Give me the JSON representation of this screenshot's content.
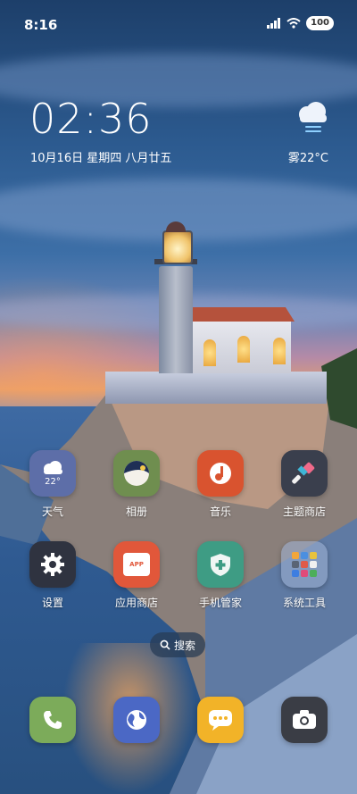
{
  "status_bar": {
    "time": "8:16",
    "battery": "100"
  },
  "clock_widget": {
    "time": "02:36",
    "date": "10月16日 星期四 八月廿五"
  },
  "weather_widget": {
    "text": "雾22°C",
    "icon": "cloud-fog-icon"
  },
  "apps": [
    {
      "name": "weather",
      "label": "天气",
      "temp": "22°",
      "icon": "cloud-icon",
      "color": "#5d6ea8"
    },
    {
      "name": "gallery",
      "label": "相册",
      "icon": "gallery-icon",
      "color": "#6f8e4f"
    },
    {
      "name": "music",
      "label": "音乐",
      "icon": "music-note-icon",
      "color": "#d9532f"
    },
    {
      "name": "themes",
      "label": "主题商店",
      "icon": "paintbrush-icon",
      "color": "#3a3f4d"
    },
    {
      "name": "settings",
      "label": "设置",
      "icon": "gear-icon",
      "color": "#2f3340"
    },
    {
      "name": "app-store",
      "label": "应用商店",
      "icon": "shopping-bag-icon",
      "badge": "APP",
      "color": "#e1573a"
    },
    {
      "name": "security",
      "label": "手机管家",
      "icon": "shield-icon",
      "color": "#3e9c84"
    },
    {
      "name": "system-tools",
      "label": "系统工具",
      "icon": "folder-icon",
      "color": "#8fa2c4"
    }
  ],
  "search": {
    "label": "搜索",
    "icon": "search-icon"
  },
  "dock": [
    {
      "name": "phone",
      "icon": "phone-icon",
      "color": "#7cab5a"
    },
    {
      "name": "browser",
      "icon": "globe-icon",
      "color": "#4b68c5"
    },
    {
      "name": "messages",
      "icon": "message-icon",
      "color": "#f2b328"
    },
    {
      "name": "camera",
      "icon": "camera-icon",
      "color": "#3a3d45"
    }
  ]
}
